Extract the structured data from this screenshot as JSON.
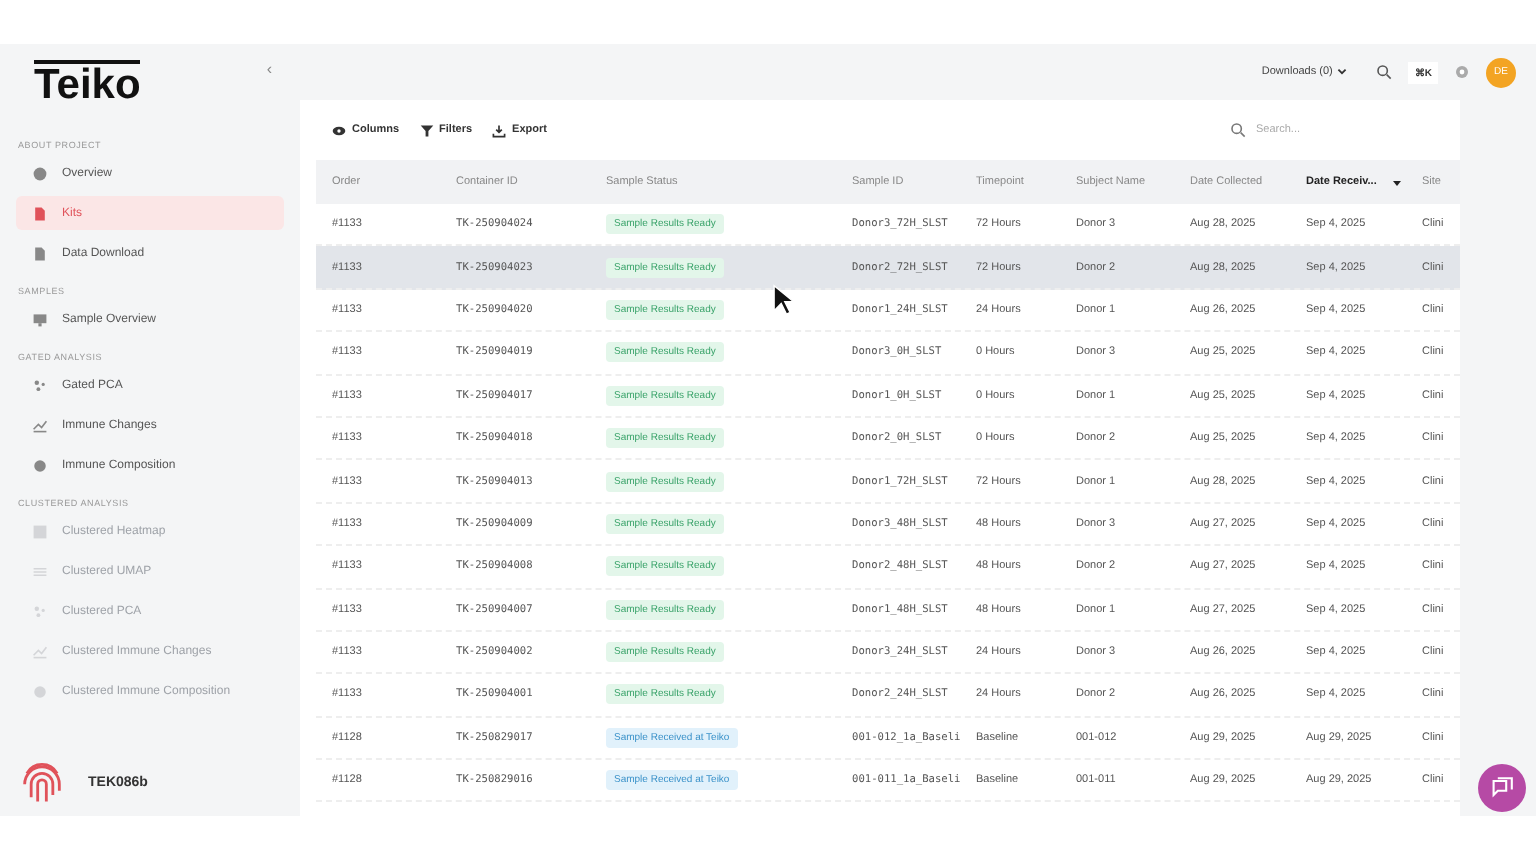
{
  "sidebar": {
    "logo": "Teiko",
    "collapse": "‹",
    "sections": [
      {
        "title": "ABOUT PROJECT",
        "items": [
          {
            "label": "Overview",
            "selected": false,
            "disabled": false
          },
          {
            "label": "Kits",
            "selected": true,
            "disabled": false
          },
          {
            "label": "Data Download",
            "selected": false,
            "disabled": false
          }
        ]
      },
      {
        "title": "SAMPLES",
        "items": [
          {
            "label": "Sample Overview",
            "selected": false,
            "disabled": false
          }
        ]
      },
      {
        "title": "GATED ANALYSIS",
        "items": [
          {
            "label": "Gated PCA",
            "selected": false,
            "disabled": false
          },
          {
            "label": "Immune Changes",
            "selected": false,
            "disabled": false
          },
          {
            "label": "Immune Composition",
            "selected": false,
            "disabled": false
          }
        ]
      },
      {
        "title": "CLUSTERED ANALYSIS",
        "items": [
          {
            "label": "Clustered Heatmap",
            "selected": false,
            "disabled": true
          },
          {
            "label": "Clustered UMAP",
            "selected": false,
            "disabled": true
          },
          {
            "label": "Clustered PCA",
            "selected": false,
            "disabled": true
          },
          {
            "label": "Clustered Immune Changes",
            "selected": false,
            "disabled": true
          },
          {
            "label": "Clustered Immune Composition",
            "selected": false,
            "disabled": true
          }
        ]
      }
    ],
    "account": "TEK086b"
  },
  "topbar": {
    "downloads": "Downloads (0)",
    "shortcut": "⌘K",
    "avatar": "DE"
  },
  "toolbar": {
    "buttons": [
      {
        "label": "Columns"
      },
      {
        "label": "Filters"
      },
      {
        "label": "Export"
      }
    ],
    "search": {
      "placeholder": "Search..."
    }
  },
  "table": {
    "columns": [
      {
        "label": "Order",
        "sorted": false
      },
      {
        "label": "Container ID",
        "sorted": false
      },
      {
        "label": "Sample Status",
        "sorted": false
      },
      {
        "label": "Sample ID",
        "sorted": false
      },
      {
        "label": "Timepoint",
        "sorted": false
      },
      {
        "label": "Subject Name",
        "sorted": false
      },
      {
        "label": "Date Collected",
        "sorted": false
      },
      {
        "label": "Date Receiv...",
        "sorted": true
      },
      {
        "label": "Site",
        "sorted": false
      }
    ],
    "rows": [
      {
        "highlighted": false,
        "cells": [
          "#1133",
          "TK-250904024",
          {
            "kind": "ready",
            "text": "Sample Results Ready"
          },
          "Donor3_72H_SLST",
          "72 Hours",
          "Donor 3",
          "Aug 28, 2025",
          "Sep 4, 2025",
          "Clini"
        ]
      },
      {
        "highlighted": true,
        "cells": [
          "#1133",
          "TK-250904023",
          {
            "kind": "ready",
            "text": "Sample Results Ready"
          },
          "Donor2_72H_SLST",
          "72 Hours",
          "Donor 2",
          "Aug 28, 2025",
          "Sep 4, 2025",
          "Clini"
        ]
      },
      {
        "highlighted": false,
        "cells": [
          "#1133",
          "TK-250904020",
          {
            "kind": "ready",
            "text": "Sample Results Ready"
          },
          "Donor1_24H_SLST",
          "24 Hours",
          "Donor 1",
          "Aug 26, 2025",
          "Sep 4, 2025",
          "Clini"
        ]
      },
      {
        "highlighted": false,
        "cells": [
          "#1133",
          "TK-250904019",
          {
            "kind": "ready",
            "text": "Sample Results Ready"
          },
          "Donor3_0H_SLST",
          "0 Hours",
          "Donor 3",
          "Aug 25, 2025",
          "Sep 4, 2025",
          "Clini"
        ]
      },
      {
        "highlighted": false,
        "cells": [
          "#1133",
          "TK-250904017",
          {
            "kind": "ready",
            "text": "Sample Results Ready"
          },
          "Donor1_0H_SLST",
          "0 Hours",
          "Donor 1",
          "Aug 25, 2025",
          "Sep 4, 2025",
          "Clini"
        ]
      },
      {
        "highlighted": false,
        "cells": [
          "#1133",
          "TK-250904018",
          {
            "kind": "ready",
            "text": "Sample Results Ready"
          },
          "Donor2_0H_SLST",
          "0 Hours",
          "Donor 2",
          "Aug 25, 2025",
          "Sep 4, 2025",
          "Clini"
        ]
      },
      {
        "highlighted": false,
        "cells": [
          "#1133",
          "TK-250904013",
          {
            "kind": "ready",
            "text": "Sample Results Ready"
          },
          "Donor1_72H_SLST",
          "72 Hours",
          "Donor 1",
          "Aug 28, 2025",
          "Sep 4, 2025",
          "Clini"
        ]
      },
      {
        "highlighted": false,
        "cells": [
          "#1133",
          "TK-250904009",
          {
            "kind": "ready",
            "text": "Sample Results Ready"
          },
          "Donor3_48H_SLST",
          "48 Hours",
          "Donor 3",
          "Aug 27, 2025",
          "Sep 4, 2025",
          "Clini"
        ]
      },
      {
        "highlighted": false,
        "cells": [
          "#1133",
          "TK-250904008",
          {
            "kind": "ready",
            "text": "Sample Results Ready"
          },
          "Donor2_48H_SLST",
          "48 Hours",
          "Donor 2",
          "Aug 27, 2025",
          "Sep 4, 2025",
          "Clini"
        ]
      },
      {
        "highlighted": false,
        "cells": [
          "#1133",
          "TK-250904007",
          {
            "kind": "ready",
            "text": "Sample Results Ready"
          },
          "Donor1_48H_SLST",
          "48 Hours",
          "Donor 1",
          "Aug 27, 2025",
          "Sep 4, 2025",
          "Clini"
        ]
      },
      {
        "highlighted": false,
        "cells": [
          "#1133",
          "TK-250904002",
          {
            "kind": "ready",
            "text": "Sample Results Ready"
          },
          "Donor3_24H_SLST",
          "24 Hours",
          "Donor 3",
          "Aug 26, 2025",
          "Sep 4, 2025",
          "Clini"
        ]
      },
      {
        "highlighted": false,
        "cells": [
          "#1133",
          "TK-250904001",
          {
            "kind": "ready",
            "text": "Sample Results Ready"
          },
          "Donor2_24H_SLST",
          "24 Hours",
          "Donor 2",
          "Aug 26, 2025",
          "Sep 4, 2025",
          "Clini"
        ]
      },
      {
        "highlighted": false,
        "cells": [
          "#1128",
          "TK-250829017",
          {
            "kind": "received",
            "text": "Sample Received at Teiko"
          },
          "001-012_1a_Baseli",
          "Baseline",
          "001-012",
          "Aug 29, 2025",
          "Aug 29, 2025",
          "Clini"
        ]
      },
      {
        "highlighted": false,
        "cells": [
          "#1128",
          "TK-250829016",
          {
            "kind": "received",
            "text": "Sample Received at Teiko"
          },
          "001-011_1a_Baseli",
          "Baseline",
          "001-011",
          "Aug 29, 2025",
          "Aug 29, 2025",
          "Clini"
        ]
      }
    ]
  }
}
